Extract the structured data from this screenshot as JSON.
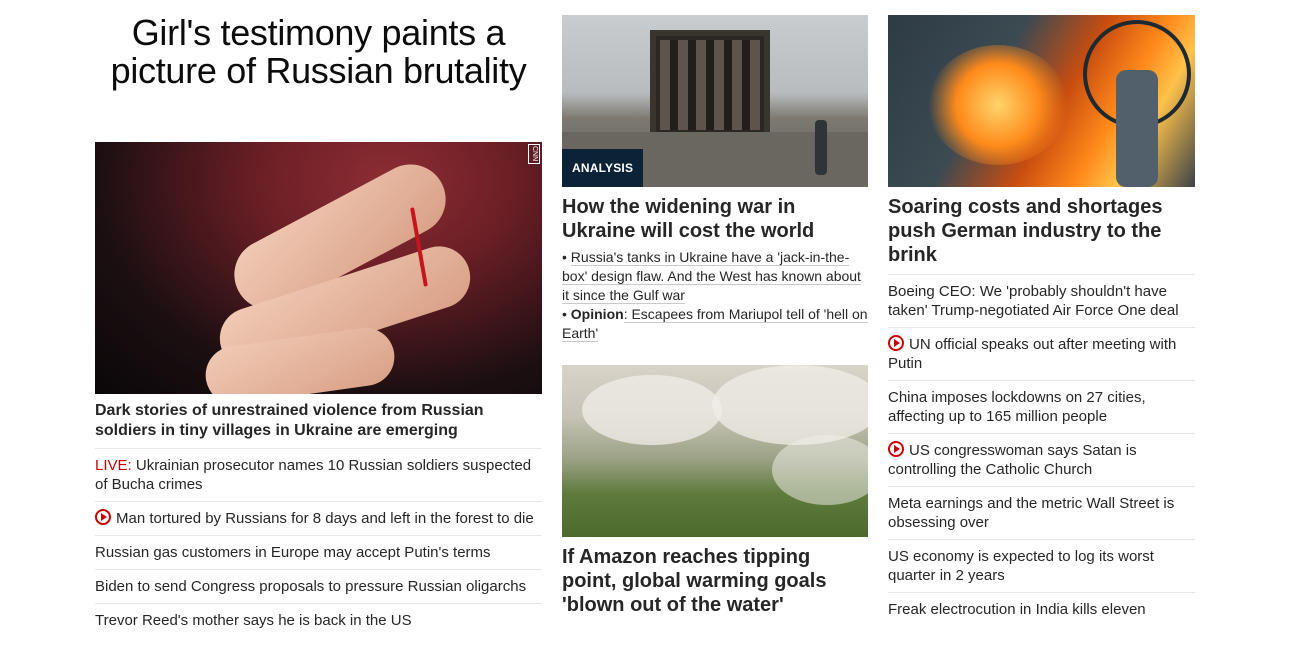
{
  "column1": {
    "headline": "Girl's testimony paints a picture of Russian brutality",
    "image_watermark": "CNN",
    "subheadline": "Dark stories of unrestrained violence from Russian soldiers in tiny villages in Ukraine are emerging",
    "items": [
      {
        "prefix": "LIVE:",
        "text": " Ukrainian prosecutor names 10 Russian soldiers suspected of Bucha crimes"
      },
      {
        "video": true,
        "text": "Man tortured by Russians for 8 days and left in the forest to die"
      },
      {
        "text": "Russian gas customers in Europe may accept Putin's terms"
      },
      {
        "text": "Biden to send Congress proposals to pressure Russian oligarchs"
      },
      {
        "text": "Trevor Reed's mother says he is back in the US"
      }
    ]
  },
  "column2": {
    "story1": {
      "badge": "ANALYSIS",
      "headline": "How the widening war in Ukraine will cost the world",
      "bullet1": "Russia's tanks in Ukraine have a 'jack-in-the-box' design flaw. And the West has known about it since the Gulf war",
      "bullet2_label": "Opinion",
      "bullet2_text": ": Escapees from Mariupol tell of 'hell on Earth'"
    },
    "story2": {
      "headline": "If Amazon reaches tipping point, global warming goals 'blown out of the water'"
    }
  },
  "column3": {
    "headline": "Soaring costs and shortages push German industry to the brink",
    "items": [
      {
        "text": "Boeing CEO: We 'probably shouldn't have taken' Trump-negotiated Air Force One deal"
      },
      {
        "video": true,
        "text": "UN official speaks out after meeting with Putin"
      },
      {
        "text": "China imposes lockdowns on 27 cities, affecting up to 165 million people"
      },
      {
        "video": true,
        "text": "US congresswoman says Satan is controlling the Catholic Church"
      },
      {
        "text": "Meta earnings and the metric Wall Street is obsessing over"
      },
      {
        "text": "US economy is expected to log its worst quarter in 2 years"
      },
      {
        "text": "Freak electrocution in India kills eleven"
      }
    ]
  },
  "colors": {
    "live": "#cc0000",
    "badge_bg": "#0c2337",
    "text": "#262626"
  }
}
